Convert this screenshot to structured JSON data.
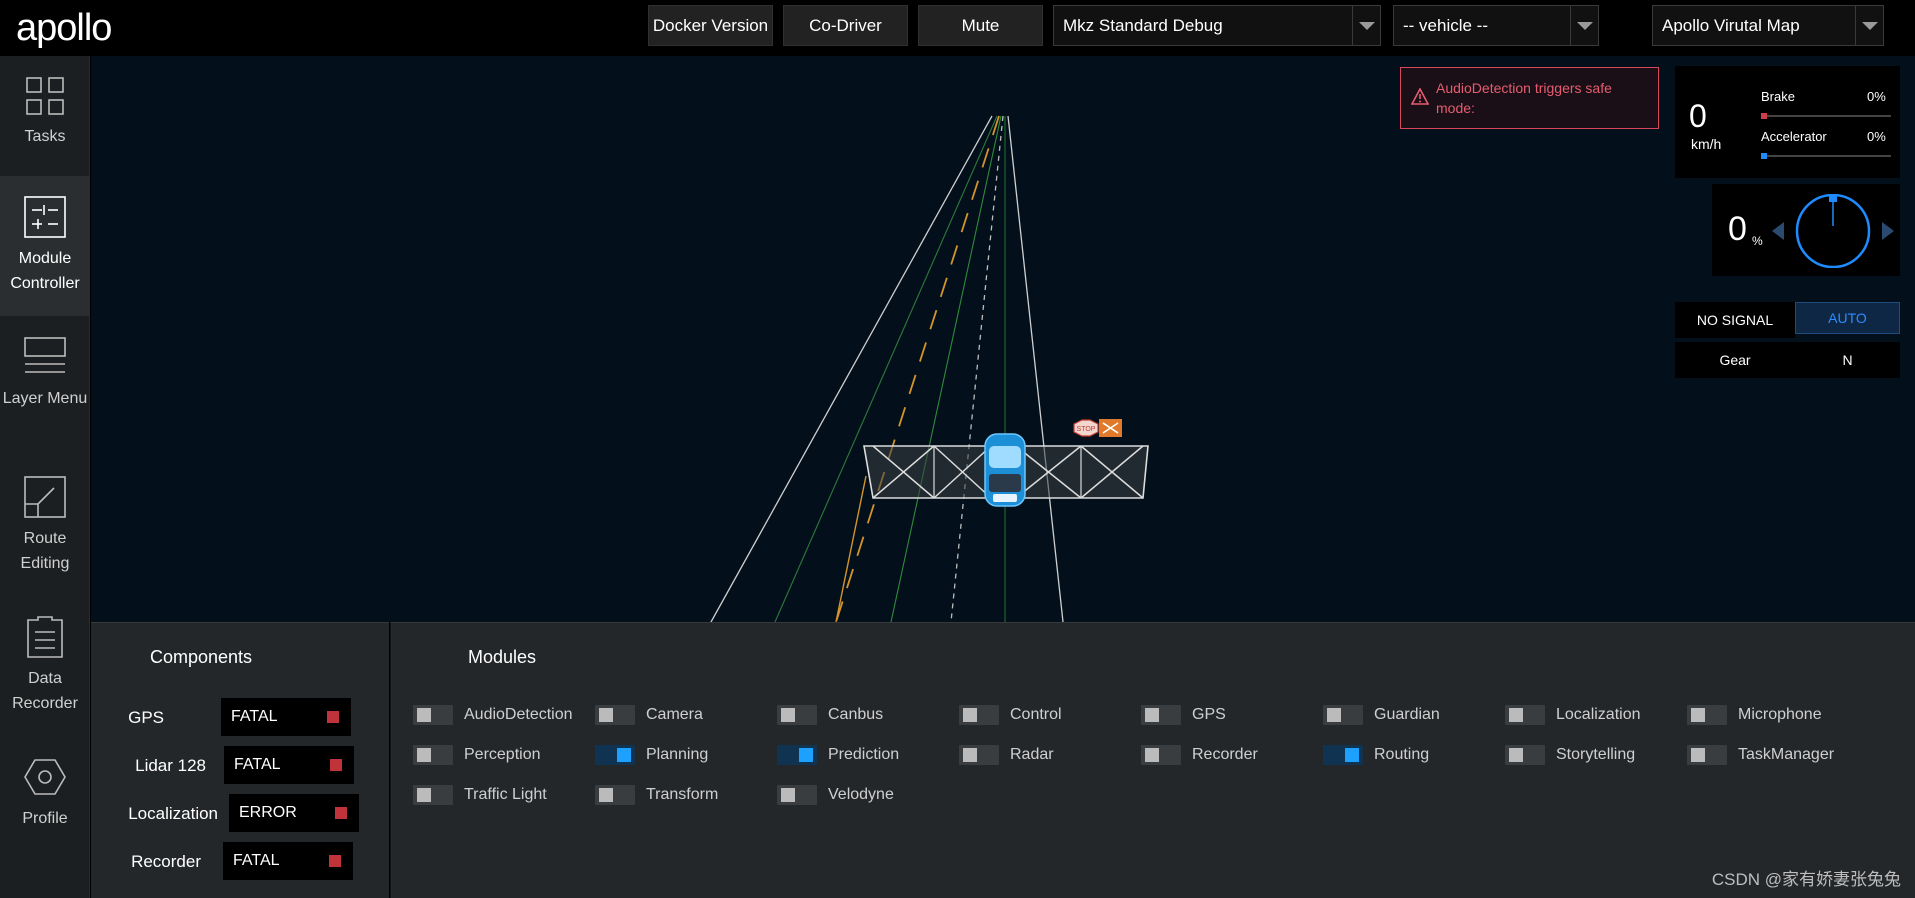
{
  "header": {
    "logo_text": "apollo",
    "buttons": {
      "docker_version": "Docker Version",
      "co_driver": "Co-Driver",
      "mute": "Mute"
    },
    "mode_select": "Mkz Standard Debug",
    "vehicle_select": "-- vehicle --",
    "map_select": "Apollo Virutal Map"
  },
  "sidebar": {
    "items": [
      {
        "label": "Tasks",
        "icon": "grid-icon"
      },
      {
        "label": "Module Controller",
        "icon": "sliders-icon",
        "active": true
      },
      {
        "label": "Layer Menu",
        "icon": "layers-icon"
      },
      {
        "label": "Route Editing",
        "icon": "route-icon"
      },
      {
        "label": "Data Recorder",
        "icon": "document-icon"
      },
      {
        "label": "Profile",
        "icon": "hexagon-icon"
      }
    ]
  },
  "alert": {
    "text": "AudioDetection triggers safe mode:",
    "icon": "warning-icon",
    "color": "#e65c70"
  },
  "dashboard": {
    "speed": "0",
    "speed_unit": "km/h",
    "brake_label": "Brake",
    "brake_value": "0%",
    "brake_level": 0,
    "accelerator_label": "Accelerator",
    "accelerator_value": "0%",
    "accelerator_level": 0,
    "steering": "0",
    "steering_unit": "%",
    "signal": "NO SIGNAL",
    "drive_mode": "AUTO",
    "gear_label": "Gear",
    "gear_value": "N"
  },
  "components": {
    "title": "Components",
    "items": [
      {
        "name": "GPS",
        "status": "FATAL"
      },
      {
        "name": "Lidar 128",
        "status": "FATAL"
      },
      {
        "name": "Localization",
        "status": "ERROR"
      },
      {
        "name": "Recorder",
        "status": "FATAL"
      }
    ]
  },
  "modules": {
    "title": "Modules",
    "items": [
      {
        "name": "AudioDetection",
        "on": false
      },
      {
        "name": "Camera",
        "on": false
      },
      {
        "name": "Canbus",
        "on": false
      },
      {
        "name": "Control",
        "on": false
      },
      {
        "name": "GPS",
        "on": false
      },
      {
        "name": "Guardian",
        "on": false
      },
      {
        "name": "Localization",
        "on": false
      },
      {
        "name": "Microphone",
        "on": false
      },
      {
        "name": "Perception",
        "on": false
      },
      {
        "name": "Planning",
        "on": true
      },
      {
        "name": "Prediction",
        "on": true
      },
      {
        "name": "Radar",
        "on": false
      },
      {
        "name": "Recorder",
        "on": false
      },
      {
        "name": "Routing",
        "on": true
      },
      {
        "name": "Storytelling",
        "on": false
      },
      {
        "name": "TaskManager",
        "on": false
      },
      {
        "name": "Traffic Light",
        "on": false
      },
      {
        "name": "Transform",
        "on": false
      },
      {
        "name": "Velodyne",
        "on": false
      }
    ]
  },
  "scene": {
    "stop_sign_text": "STOP"
  },
  "watermark": "CSDN @家有娇妻张兔兔",
  "colors": {
    "accent": "#1ea0ff",
    "fatal": "#c0333a",
    "scene_bg": "#03101c"
  }
}
